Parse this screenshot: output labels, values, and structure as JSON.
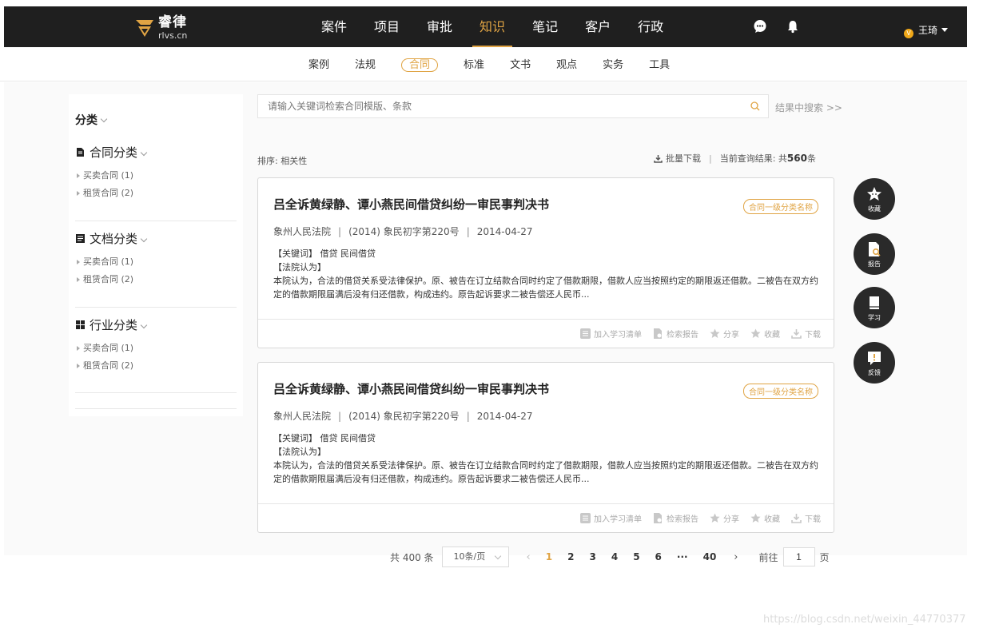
{
  "brand": {
    "name_cn": "睿律",
    "domain": "rlvs.cn",
    "accent": "#e0a444"
  },
  "nav": {
    "items": [
      {
        "label": "案件",
        "active": false
      },
      {
        "label": "项目",
        "active": false
      },
      {
        "label": "审批",
        "active": false
      },
      {
        "label": "知识",
        "active": true
      },
      {
        "label": "笔记",
        "active": false
      },
      {
        "label": "客户",
        "active": false
      },
      {
        "label": "行政",
        "active": false
      }
    ],
    "icons": [
      "chat-icon",
      "bell-icon"
    ],
    "user": {
      "name": "王琦",
      "badge": "V"
    }
  },
  "subnav": {
    "items": [
      {
        "label": "案例",
        "active": false
      },
      {
        "label": "法规",
        "active": false
      },
      {
        "label": "合同",
        "active": true
      },
      {
        "label": "标准",
        "active": false
      },
      {
        "label": "文书",
        "active": false
      },
      {
        "label": "观点",
        "active": false
      },
      {
        "label": "实务",
        "active": false
      },
      {
        "label": "工具",
        "active": false
      }
    ]
  },
  "sidebar": {
    "heading": "分类",
    "categories": [
      {
        "title": "合同分类",
        "icon": "contract-icon",
        "items": [
          "买卖合同 (1)",
          "租赁合同 (2)"
        ]
      },
      {
        "title": "文档分类",
        "icon": "document-icon",
        "items": [
          "买卖合同 (1)",
          "租赁合同 (2)"
        ]
      },
      {
        "title": "行业分类",
        "icon": "grid-icon",
        "items": [
          "买卖合同 (1)",
          "租赁合同 (2)"
        ]
      }
    ]
  },
  "search": {
    "placeholder": "请输入关键词检索合同模版、条款",
    "within_label": "结果中搜索 >>"
  },
  "results_meta": {
    "sort_label": "排序: 相关性",
    "batch_download": "批量下载",
    "separator": "|",
    "count_prefix": "当前查询结果: 共",
    "count": "560",
    "count_suffix": "条"
  },
  "results": [
    {
      "title": "吕全诉黄绿静、谭小燕民间借贷纠纷一审民事判决书",
      "tag": "合同一级分类名称",
      "court": "象州人民法院",
      "case_no": "(2014) 象民初字第220号",
      "date": "2014-04-27",
      "keywords": "【关键词】 借贷 民间借贷",
      "opinion_label": "【法院认为】",
      "excerpt": "本院认为，合法的借贷关系受法律保护。原、被告在订立结款合同时约定了借款期限，借款人应当按照约定的期限返还借款。二被告在双方约定的借款期限届满后没有归还借款，构成违约。原告起诉要求二被告偿还人民币...",
      "actions": [
        "加入学习清单",
        "检索报告",
        "分享",
        "收藏",
        "下载"
      ]
    },
    {
      "title": "吕全诉黄绿静、谭小燕民间借贷纠纷一审民事判决书",
      "tag": "合同一级分类名称",
      "court": "象州人民法院",
      "case_no": "(2014) 象民初字第220号",
      "date": "2014-04-27",
      "keywords": "【关键词】 借贷 民间借贷",
      "opinion_label": "【法院认为】",
      "excerpt": "本院认为，合法的借贷关系受法律保护。原、被告在订立结款合同时约定了借款期限，借款人应当按照约定的期限返还借款。二被告在双方约定的借款期限届满后没有归还借款，构成违约。原告起诉要求二被告偿还人民币...",
      "actions": [
        "加入学习清单",
        "检索报告",
        "分享",
        "收藏",
        "下载"
      ]
    }
  ],
  "float_buttons": [
    {
      "label": "收藏",
      "icon": "star-icon"
    },
    {
      "label": "报告",
      "icon": "report-icon"
    },
    {
      "label": "学习",
      "icon": "book-icon"
    },
    {
      "label": "反馈",
      "icon": "feedback-icon"
    }
  ],
  "pagination": {
    "total": "共 400 条",
    "page_size": "10条/页",
    "pages": [
      "1",
      "2",
      "3",
      "4",
      "5",
      "6",
      "···",
      "40"
    ],
    "current": "1",
    "goto_label": "前往",
    "goto_value": "1",
    "page_suffix": "页"
  },
  "watermark": "https://blog.csdn.net/weixin_44770377"
}
